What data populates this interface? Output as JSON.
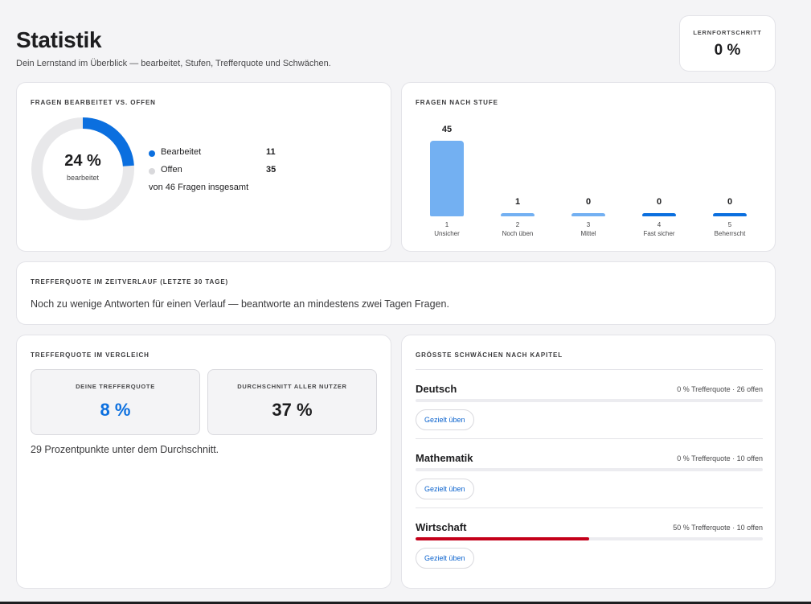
{
  "page": {
    "title": "Statistik",
    "subtitle": "Dein Lernstand im Überblick — bearbeitet, Stufen, Trefferquote und Schwächen."
  },
  "progress": {
    "label": "LERNFORTSCHRITT",
    "value": "0 %"
  },
  "donut": {
    "title": "FRAGEN BEARBEITET VS. OFFEN",
    "percent_label": "24 %",
    "percent_sub": "bearbeitet",
    "fraction_done": 0.239,
    "legend": [
      {
        "label": "Bearbeitet",
        "value": "11",
        "color": "#0b6fdf"
      },
      {
        "label": "Offen",
        "value": "35",
        "color": "#d9d9dc"
      }
    ],
    "total_text": "von 46 Fragen insgesamt"
  },
  "levels": {
    "title": "FRAGEN NACH STUFE",
    "items": [
      {
        "num": "1",
        "name": "Unsicher",
        "count": "45",
        "value": 45,
        "color": "#73b0f2"
      },
      {
        "num": "2",
        "name": "Noch üben",
        "count": "1",
        "value": 1,
        "color": "#73b0f2"
      },
      {
        "num": "3",
        "name": "Mittel",
        "count": "0",
        "value": 0,
        "color": "#73b0f2"
      },
      {
        "num": "4",
        "name": "Fast sicher",
        "count": "0",
        "value": 0,
        "color": "#0b6fdf"
      },
      {
        "num": "5",
        "name": "Beherrscht",
        "count": "0",
        "value": 0,
        "color": "#0b6fdf"
      }
    ]
  },
  "timeline": {
    "title": "TREFFERQUOTE IM ZEITVERLAUF (LETZTE 30 TAGE)",
    "message": "Noch zu wenige Antworten für einen Verlauf — beantworte an mindestens zwei Tagen Fragen."
  },
  "compare": {
    "title": "TREFFERQUOTE IM VERGLEICH",
    "yours_label": "DEINE TREFFERQUOTE",
    "yours_value": "8 %",
    "avg_label": "DURCHSCHNITT ALLER NUTZER",
    "avg_value": "37 %",
    "note": "29 Prozentpunkte unter dem Durchschnitt.",
    "accent_color": "#0b6fdf"
  },
  "weaknesses": {
    "title": "GRÖSSTE SCHWÄCHEN NACH KAPITEL",
    "items": [
      {
        "name": "Deutsch",
        "stat": "0 % Trefferquote · 26 offen",
        "rate": 0,
        "button": "Gezielt üben"
      },
      {
        "name": "Mathematik",
        "stat": "0 % Trefferquote · 10 offen",
        "rate": 0,
        "button": "Gezielt üben"
      },
      {
        "name": "Wirtschaft",
        "stat": "50 % Trefferquote · 10 offen",
        "rate": 0.5,
        "button": "Gezielt üben"
      }
    ]
  }
}
